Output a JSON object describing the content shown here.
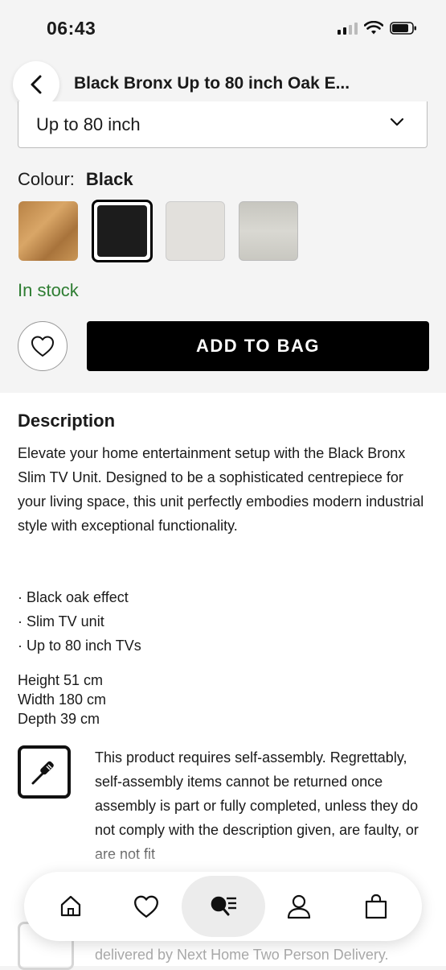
{
  "status_bar": {
    "time": "06:43"
  },
  "header": {
    "title": "Black Bronx Up to 80 inch Oak E..."
  },
  "size_select": {
    "value": "Up to 80 inch"
  },
  "colour": {
    "label": "Colour:",
    "selected": "Black",
    "swatches": [
      "oak",
      "black",
      "white",
      "grey"
    ]
  },
  "stock_status": "In stock",
  "add_to_bag_label": "ADD TO BAG",
  "description": {
    "title": "Description",
    "text": "Elevate your home entertainment setup with the Black Bronx Slim TV Unit. Designed to be a sophisticated centrepiece for your living space, this unit perfectly embodies modern industrial style with exceptional functionality.",
    "bullets": [
      "· Black oak effect",
      "· Slim TV unit",
      "· Up to 80 inch TVs"
    ],
    "dimensions": [
      "Height 51 cm",
      "Width 180 cm",
      "Depth 39 cm"
    ]
  },
  "assembly": {
    "text": "This product requires self-assembly. Regrettably, self-assembly items cannot be returned once assembly is part or fully completed, unless they do not comply with the description given, are faulty, or are not fit"
  },
  "delivery_text": "delivered by Next Home Two Person Delivery.",
  "nav": {
    "items": [
      "home-icon",
      "heart-icon",
      "search-icon",
      "account-icon",
      "bag-icon"
    ]
  }
}
